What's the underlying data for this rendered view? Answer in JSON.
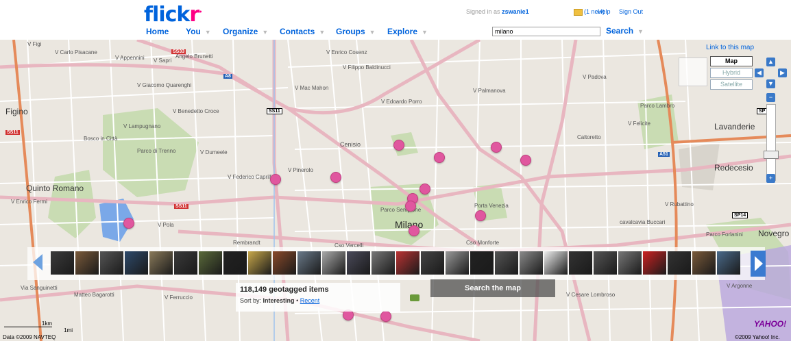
{
  "header": {
    "logo_main": "flick",
    "logo_r": "r",
    "logo_mark": "•",
    "nav": [
      {
        "label": "Home"
      },
      {
        "label": "You"
      },
      {
        "label": "Organize"
      },
      {
        "label": "Contacts"
      },
      {
        "label": "Groups"
      },
      {
        "label": "Explore"
      }
    ],
    "signed_in_prefix": "Signed in as",
    "username": "zswanie1",
    "mail_count": "(1 new)",
    "help": "Help",
    "sign_out": "Sign Out",
    "search_value": "milano",
    "search_button": "Search"
  },
  "map": {
    "link_to_map": "Link to this map",
    "map_types": [
      "Map",
      "Hybrid",
      "Satellite"
    ],
    "active_type": "Map",
    "places": [
      {
        "name": "Figino"
      },
      {
        "name": "Quinto Romano"
      },
      {
        "name": "Milano"
      },
      {
        "name": "Lavanderie"
      },
      {
        "name": "Redecesio"
      },
      {
        "name": "Novegro"
      },
      {
        "name": "Cenisio"
      }
    ],
    "streets": [
      "V Figi",
      "V Carlo Pisacane",
      "V Appennini",
      "V Sapri",
      "Angelo Brunetti",
      "V Enrico Cosenz",
      "V Filippo Baldinucci",
      "V Giacomo Quarenghi",
      "V Benedetto Croce",
      "V Mac Mahon",
      "V Lampugnano",
      "Parco di Trenno",
      "Bosco in Città",
      "V Federico Caprilli",
      "V Pinerolo",
      "V Edoardo Porro",
      "V Padova",
      "V Palmanova",
      "V Dumeele",
      "Caltoretto",
      "Parco Lambro",
      "V Felicite",
      "Parco Sempione",
      "Porta Venezia",
      "Rembrandt",
      "Cso Vercelli",
      "Cso Monforte",
      "V Rubattino",
      "V Enrico Fermi",
      "Via Sanguinetti",
      "Matteo Bagarotti",
      "V Ferruccio",
      "V Pola",
      "Parco Forlanini",
      "V Cesare Lombroso",
      "V Argonne",
      "cavalcavia Buccari"
    ]
  },
  "strip": {
    "thumb_count": 28
  },
  "info": {
    "count": "118,149 geotagged items",
    "sort_prefix": "Sort by:",
    "sort_active": "Interesting",
    "sort_sep": "•",
    "sort_other": "Recent"
  },
  "search_map_button": "Search the map",
  "scale": {
    "km": "1km",
    "mi": "1mi"
  },
  "copyright_left": "Data ©2009 NAVTEQ",
  "copyright_right": "©2009 Yahoo! Inc.",
  "yahoo_logo": "YAHOO!",
  "colors": {
    "flickr_blue": "#0063dc",
    "flickr_pink": "#ff0084",
    "pin": "#e0579f",
    "map_bg": "#ebe7e0",
    "park": "#c9dcb3",
    "water": "#7aa8e8"
  }
}
